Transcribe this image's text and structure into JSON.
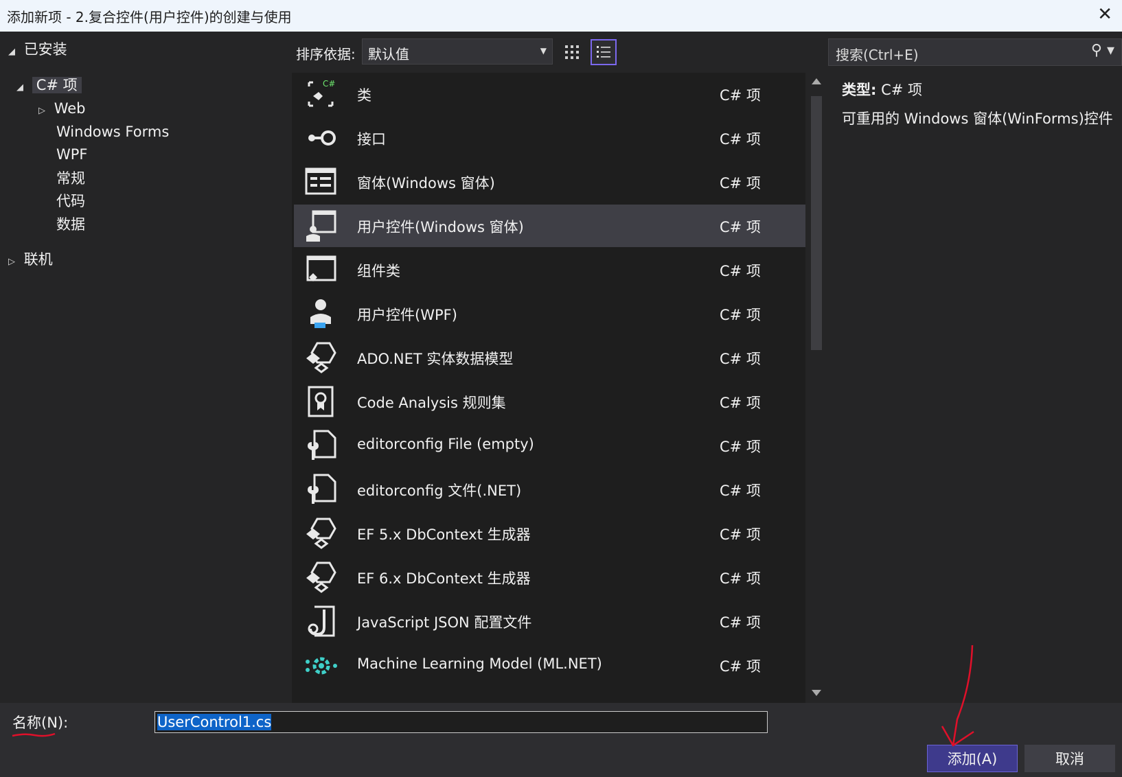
{
  "window": {
    "title": "添加新项 - 2.复合控件(用户控件)的创建与使用",
    "close_glyph": "✕"
  },
  "sidebar": {
    "installed_label": "已安装",
    "csharp_label": "C# 项",
    "children": [
      "Web",
      "Windows Forms",
      "WPF",
      "常规",
      "代码",
      "数据"
    ],
    "online_label": "联机"
  },
  "toolbar": {
    "sort_label": "排序依据:",
    "sort_value": "默认值",
    "search_placeholder": "搜索(Ctrl+E)"
  },
  "items": [
    {
      "name": "类",
      "kind": "C# 项",
      "icon": "class-icon"
    },
    {
      "name": "接口",
      "kind": "C# 项",
      "icon": "interface-icon"
    },
    {
      "name": "窗体(Windows 窗体)",
      "kind": "C# 项",
      "icon": "form-icon"
    },
    {
      "name": "用户控件(Windows 窗体)",
      "kind": "C# 项",
      "icon": "user-control-icon"
    },
    {
      "name": "组件类",
      "kind": "C# 项",
      "icon": "component-class-icon"
    },
    {
      "name": "用户控件(WPF)",
      "kind": "C# 项",
      "icon": "wpf-user-control-icon"
    },
    {
      "name": "ADO.NET 实体数据模型",
      "kind": "C# 项",
      "icon": "entity-model-icon"
    },
    {
      "name": "Code Analysis 规则集",
      "kind": "C# 项",
      "icon": "ruleset-icon"
    },
    {
      "name": "editorconfig File (empty)",
      "kind": "C# 项",
      "icon": "editorconfig-icon"
    },
    {
      "name": "editorconfig 文件(.NET)",
      "kind": "C# 项",
      "icon": "editorconfig-icon"
    },
    {
      "name": "EF 5.x DbContext 生成器",
      "kind": "C# 项",
      "icon": "entity-model-icon"
    },
    {
      "name": "EF 6.x DbContext 生成器",
      "kind": "C# 项",
      "icon": "entity-model-icon"
    },
    {
      "name": "JavaScript JSON 配置文件",
      "kind": "C# 项",
      "icon": "json-icon"
    },
    {
      "name": "Machine Learning Model (ML.NET)",
      "kind": "C# 项",
      "icon": "ml-model-icon"
    }
  ],
  "selected_index": 3,
  "detail": {
    "type_label": "类型:",
    "type_value": "C# 项",
    "description": "可重用的 Windows 窗体(WinForms)控件"
  },
  "footer": {
    "name_label": "名称(N):",
    "name_value": "UserControl1.cs",
    "add_label": "添加(A)",
    "cancel_label": "取消"
  },
  "colors": {
    "accent": "#7b68ee",
    "add_button": "#3e3a8c",
    "selection": "#0e64c8",
    "annotation": "#e0102a"
  }
}
